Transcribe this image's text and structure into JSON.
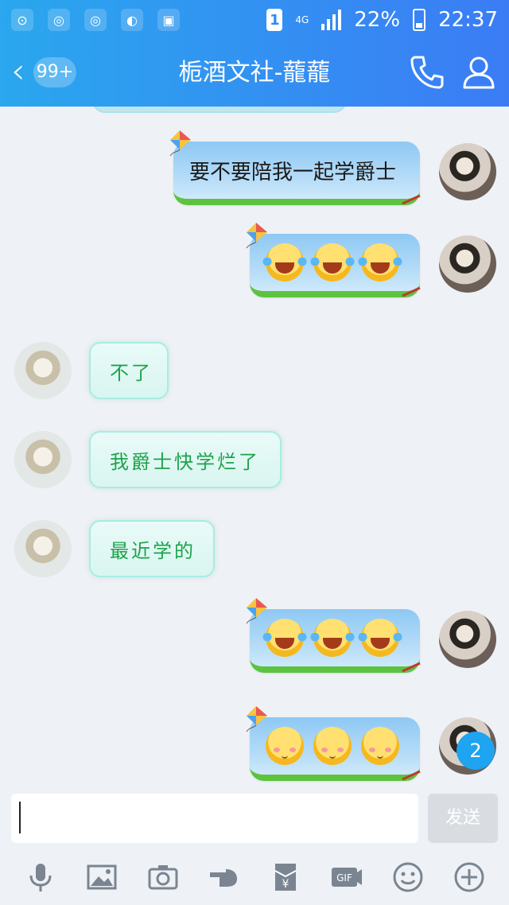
{
  "status_bar": {
    "battery": "22%",
    "time": "22:37",
    "network": "4G",
    "sim_slot": "1"
  },
  "header": {
    "back_badge": "99+",
    "title": "栀酒文社-蘢蘢"
  },
  "messages": [
    {
      "side": "me",
      "type": "text",
      "text": "要不要陪我一起学爵士"
    },
    {
      "side": "me",
      "type": "emoji",
      "emoji": [
        "laugh-cry-emoji",
        "laugh-cry-emoji",
        "laugh-cry-emoji"
      ]
    },
    {
      "side": "them",
      "type": "text",
      "text": "不了"
    },
    {
      "side": "them",
      "type": "text",
      "text": "我爵士快学烂了"
    },
    {
      "side": "them",
      "type": "text",
      "text": "最近学的"
    },
    {
      "side": "me",
      "type": "emoji",
      "emoji": [
        "laugh-cry-emoji",
        "laugh-cry-emoji",
        "laugh-cry-emoji"
      ]
    },
    {
      "side": "me",
      "type": "emoji",
      "emoji": [
        "shy-emoji",
        "shy-emoji",
        "shy-emoji"
      ]
    }
  ],
  "unread_count": "2",
  "input": {
    "value": "",
    "placeholder": "",
    "send_label": "发送"
  },
  "toolbar_icons": [
    "microphone-icon",
    "image-icon",
    "camera-icon",
    "poke-hand-icon",
    "red-packet-icon",
    "gif-icon",
    "emoji-icon",
    "plus-icon"
  ],
  "toolbar_labels": {
    "gif": "GIF",
    "yuan": "¥"
  },
  "colors": {
    "header_start": "#2aa7ee",
    "header_end": "#3b7cf5",
    "my_bubble": "#8ec8f4",
    "their_text": "#1ca34a",
    "badge": "#1ea4f0"
  }
}
